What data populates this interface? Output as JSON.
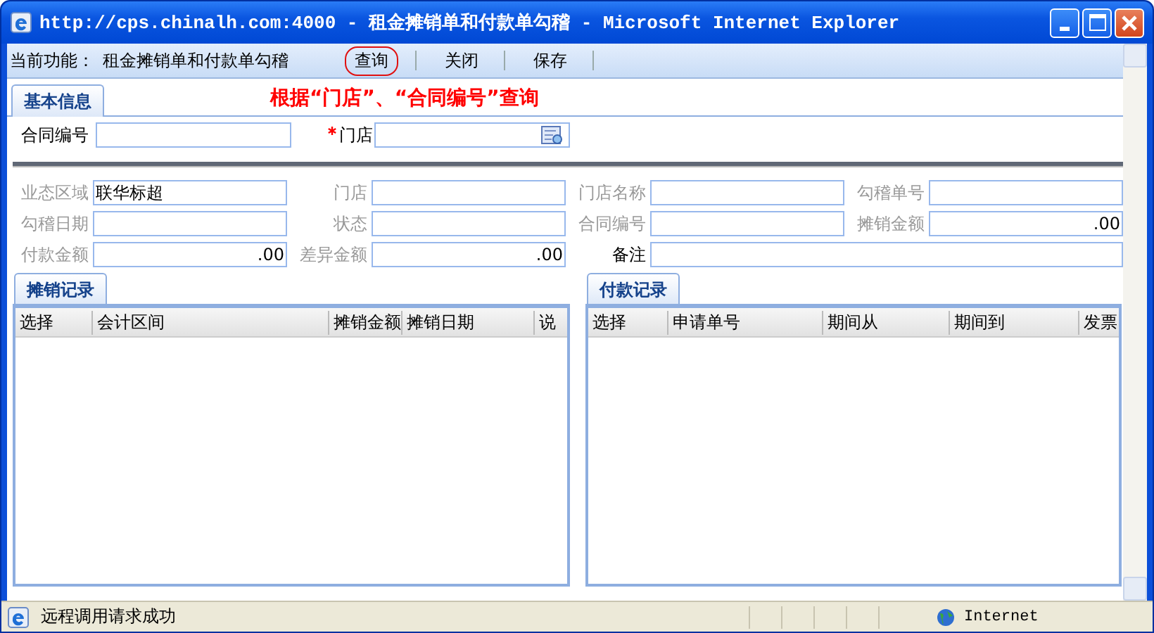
{
  "window": {
    "title": "http://cps.chinalh.com:4000 - 租金摊销单和付款单勾稽 - Microsoft Internet Explorer"
  },
  "toolbar": {
    "label": "当前功能：",
    "value": "租金摊销单和付款单勾稽",
    "buttons": [
      {
        "label": "查询",
        "circled": true
      },
      {
        "label": "关闭",
        "circled": false
      },
      {
        "label": "保存",
        "circled": false
      }
    ]
  },
  "tabs": [
    {
      "label": "基本信息",
      "selected": true
    }
  ],
  "annotation": "根据“门店”、“合同编号”查询",
  "query_fields": [
    {
      "label": "合同编号",
      "required": false,
      "kind": "text"
    },
    {
      "label": "门店",
      "required": true,
      "kind": "lookup"
    }
  ],
  "info_fields": [
    {
      "label": "业态区域",
      "value": "联华标超",
      "disabled": true,
      "kind": "text"
    },
    {
      "label": "门店",
      "disabled": true,
      "kind": "text"
    },
    {
      "label": "门店名称",
      "disabled": true,
      "kind": "text"
    },
    {
      "label": "勾稽单号",
      "disabled": true,
      "kind": "text"
    },
    {
      "label": "勾稽日期",
      "disabled": true,
      "kind": "text"
    },
    {
      "label": "状态",
      "disabled": true,
      "kind": "text"
    },
    {
      "label": "合同编号",
      "disabled": true,
      "kind": "text"
    },
    {
      "label": "摊销金额",
      "value": ".00",
      "disabled": true,
      "kind": "number"
    },
    {
      "label": "付款金额",
      "value": ".00",
      "disabled": true,
      "kind": "number"
    },
    {
      "label": "差异金额",
      "value": ".00",
      "disabled": true,
      "kind": "number"
    },
    {
      "label": "备注",
      "disabled": false,
      "kind": "wide"
    }
  ],
  "panels": [
    {
      "tab": "摊销记录",
      "columns": [
        "选择",
        "会计区间",
        "摊销金额",
        "摊销日期",
        "说"
      ]
    },
    {
      "tab": "付款记录",
      "columns": [
        "选择",
        "申请单号",
        "期间从",
        "期间到",
        "发票"
      ]
    }
  ],
  "status_bar": {
    "message": "远程调用请求成功",
    "zone": "Internet"
  }
}
